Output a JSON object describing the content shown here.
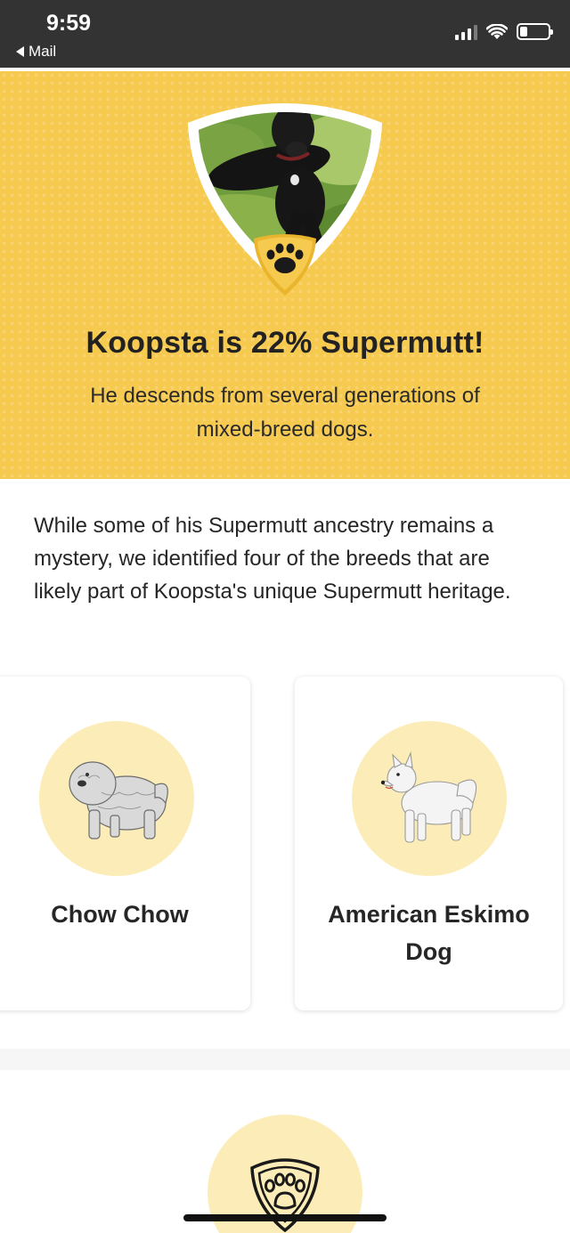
{
  "status_bar": {
    "time": "9:59",
    "back_label": "Mail"
  },
  "hero": {
    "title": "Koopsta is 22% Supermutt!",
    "subtitle": "He descends from several generations of mixed-breed dogs.",
    "photo_alt": "black dog lying in grass",
    "badge_icon": "paw-icon"
  },
  "intro": {
    "text": "While some of his Supermutt ancestry remains a mystery, we identified four of the breeds that are likely part of Koopsta's unique Supermutt heritage."
  },
  "breeds": [
    {
      "name": "Chow Chow",
      "image": "chow-chow-illustration"
    },
    {
      "name": "American Eskimo Dog",
      "image": "american-eskimo-dog-illustration"
    }
  ],
  "bottom": {
    "icon": "paw-shield-icon"
  },
  "colors": {
    "hero_background": "#f6c94f",
    "breed_circle": "#fcedb8",
    "status_bar": "#333333"
  }
}
